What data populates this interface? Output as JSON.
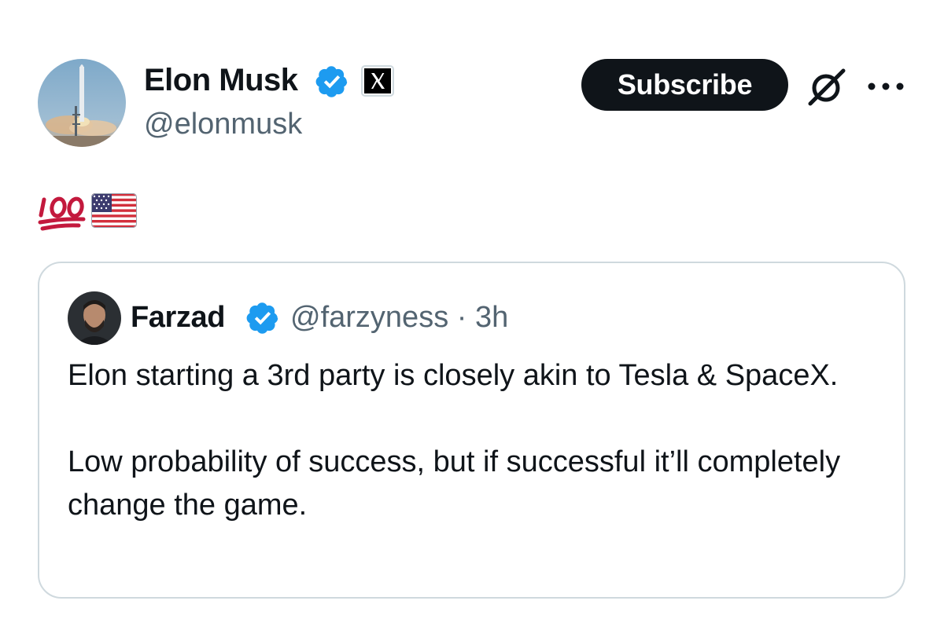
{
  "post": {
    "author_name": "Elon Musk",
    "author_handle": "@elonmusk",
    "subscribe_label": "Subscribe",
    "body_emoji": [
      "hundred-points",
      "us-flag"
    ]
  },
  "quote": {
    "author_name": "Farzad",
    "author_handle": "@farzyness",
    "separator": " · ",
    "time_ago": "3h",
    "paragraphs": [
      "Elon starting a 3rd party is closely akin to Tesla & SpaceX.",
      "Low probability of success, but if successful it’ll completely change the game."
    ]
  },
  "colors": {
    "text_primary": "#0f1419",
    "text_secondary": "#536471",
    "verified_blue": "#1d9bf0",
    "border": "#cfd9de",
    "button_bg": "#0f1419",
    "hundred_red": "#c3193d"
  },
  "icons": {
    "verified": "verified-badge-icon",
    "affiliation": "x-logo-icon",
    "grok": "grok-icon",
    "more": "more-dots-icon"
  }
}
